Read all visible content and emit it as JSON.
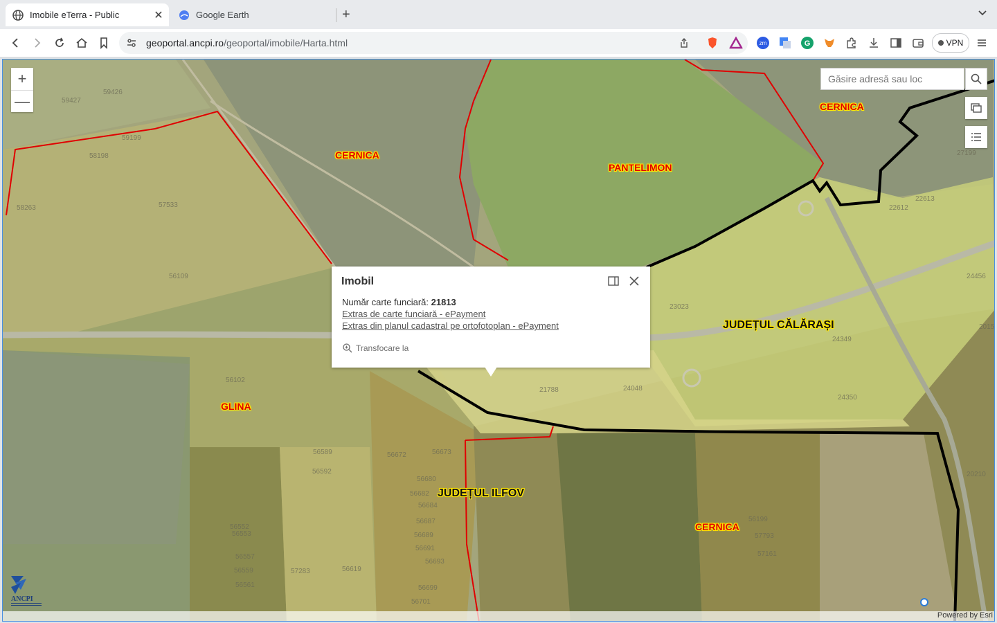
{
  "browser": {
    "tabs": [
      {
        "title": "Imobile eTerra - Public",
        "active": true,
        "icon": "globe-icon"
      },
      {
        "title": "Google Earth",
        "active": false,
        "icon": "google-earth-icon"
      }
    ],
    "url_host": "geoportal.ancpi.ro",
    "url_path": "/geoportal/imobile/Harta.html",
    "vpn_label": "VPN"
  },
  "map": {
    "search_placeholder": "Găsire adresă sau loc",
    "zoom_in_label": "+",
    "zoom_out_label": "—",
    "labels": {
      "cernica_1": "CERNICA",
      "cernica_2": "CERNICA",
      "cernica_3": "CERNICA",
      "pantelimon": "PANTELIMON",
      "glina": "GLINA",
      "calarasi": "JUDEȚUL CĂLĂRAȘI",
      "ilfov": "JUDEȚUL ILFOV"
    },
    "parcels": [
      "59426",
      "59427",
      "59199",
      "58198",
      "58263",
      "57533",
      "56109",
      "56102",
      "23023",
      "24349",
      "24350",
      "24048",
      "22612",
      "22613",
      "24456",
      "21788",
      "27199",
      "56672",
      "56673",
      "56680",
      "56682",
      "56684",
      "56687",
      "56689",
      "56691",
      "56693",
      "56699",
      "56701",
      "56557",
      "56559",
      "56561",
      "56553",
      "56552",
      "57283",
      "56619",
      "56199",
      "57793",
      "57161",
      "20210",
      "56589",
      "56592",
      "20156"
    ],
    "attribution": "Powered by Esri",
    "colors": {
      "boundary_uat": "#e00000",
      "boundary_county": "#000000",
      "label_halo": "#ffe600",
      "parcel_fill": "#ffff66"
    }
  },
  "popup": {
    "title": "Imobil",
    "cf_label": "Număr carte funciară: ",
    "cf_value": "21813",
    "link_cf": "Extras de carte funciară - ePayment",
    "link_plan": "Extras din planul cadastral pe ortofotoplan - ePayment",
    "zoom_to": "Transfocare la"
  }
}
